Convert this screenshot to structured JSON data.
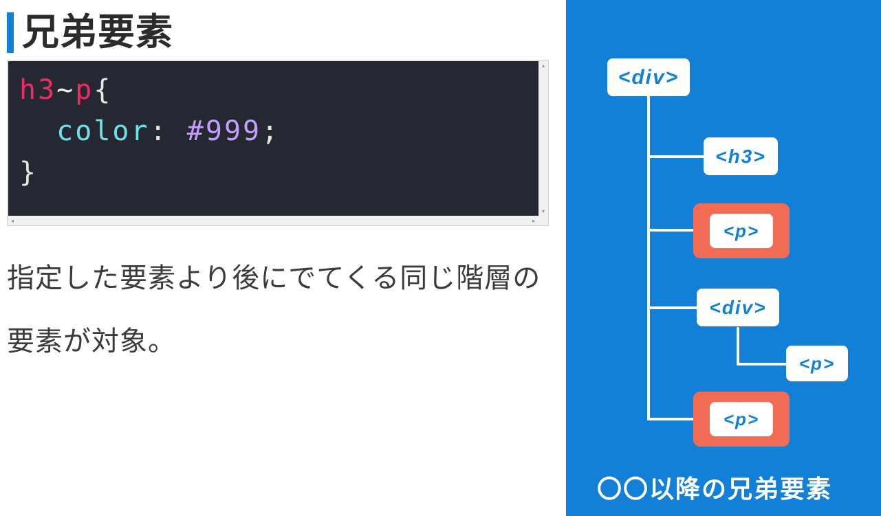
{
  "heading": "兄弟要素",
  "code": {
    "sel1": "h3",
    "tilde": "~",
    "sel2": "p",
    "brace_open": "{",
    "prop": "color",
    "colon": ":",
    "hash": "#",
    "value": "999",
    "semi": ";",
    "brace_close": "}"
  },
  "description": "指定した要素より後にでてくる同じ階層の要素が対象。",
  "diagram": {
    "root": "<div>",
    "child_h3": "<h3>",
    "child_p1": "<p>",
    "child_div": "<div>",
    "grandchild_p": "<p>",
    "child_p2": "<p>",
    "caption": "〇〇以降の兄弟要素"
  }
}
